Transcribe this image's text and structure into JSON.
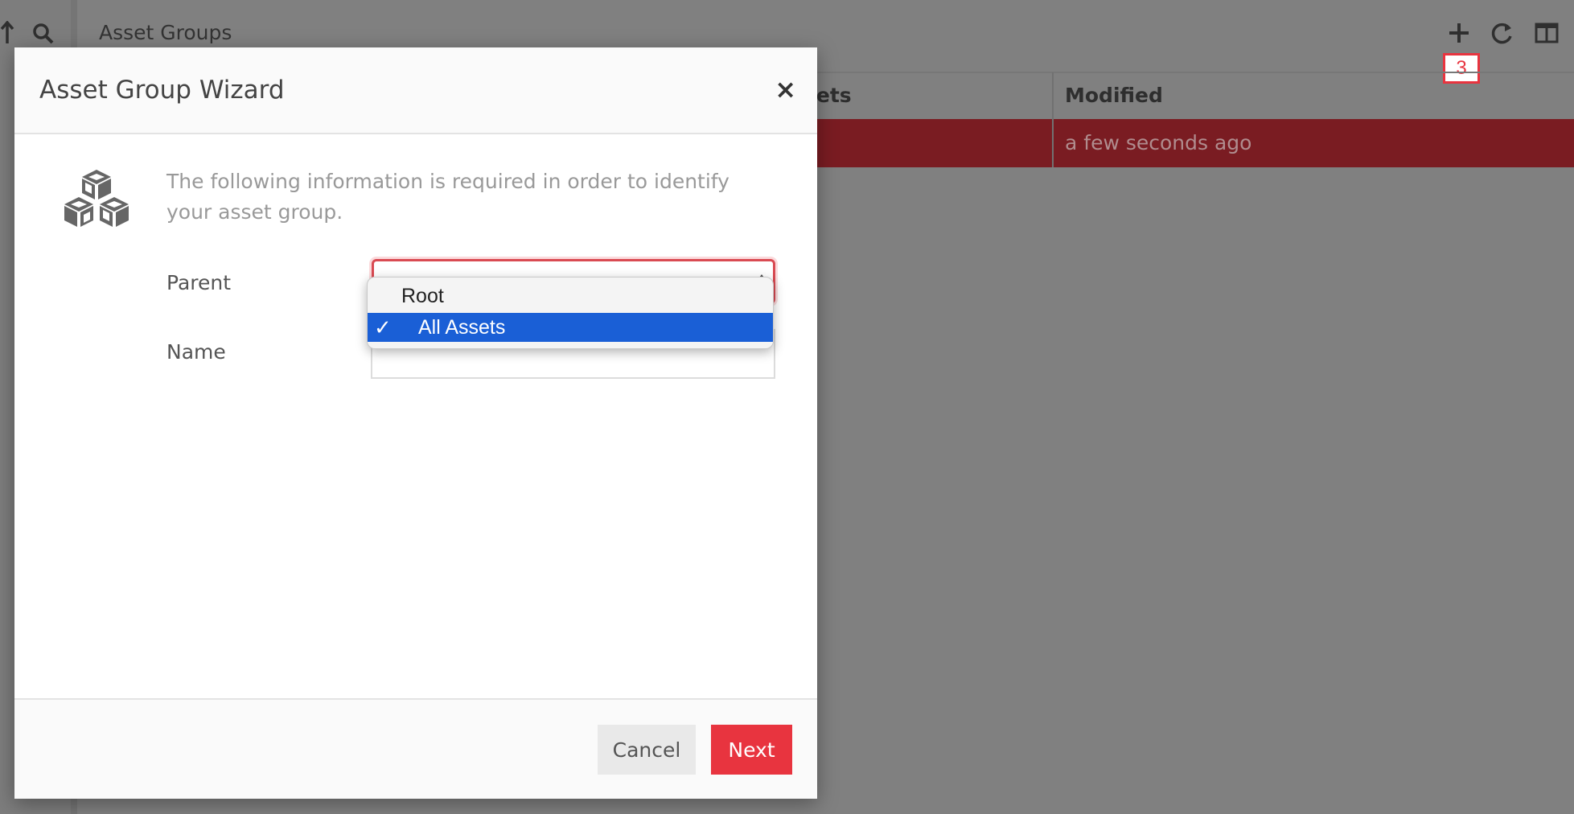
{
  "background": {
    "title": "Asset Groups",
    "columns": [
      "sets",
      "Modified"
    ],
    "row_modified": "a few seconds ago",
    "badge": "3",
    "toolbar_icons": [
      "plus-icon",
      "refresh-icon",
      "columns-icon"
    ],
    "left_icons": [
      "upload-icon",
      "search-icon"
    ]
  },
  "modal": {
    "title": "Asset Group Wizard",
    "close": "×",
    "intro": "The following information is required in order to identify your asset group.",
    "parent_label": "Parent",
    "name_label": "Name",
    "name_value": "",
    "icon": "cubes-icon",
    "cancel_label": "Cancel",
    "next_label": "Next"
  },
  "dropdown": {
    "options": [
      "Root",
      "All Assets"
    ],
    "selected": "All Assets",
    "check": "✓"
  },
  "colors": {
    "accent": "#e8343f",
    "selected_option": "#1a5fd6",
    "row_highlight": "#7a1c22"
  }
}
